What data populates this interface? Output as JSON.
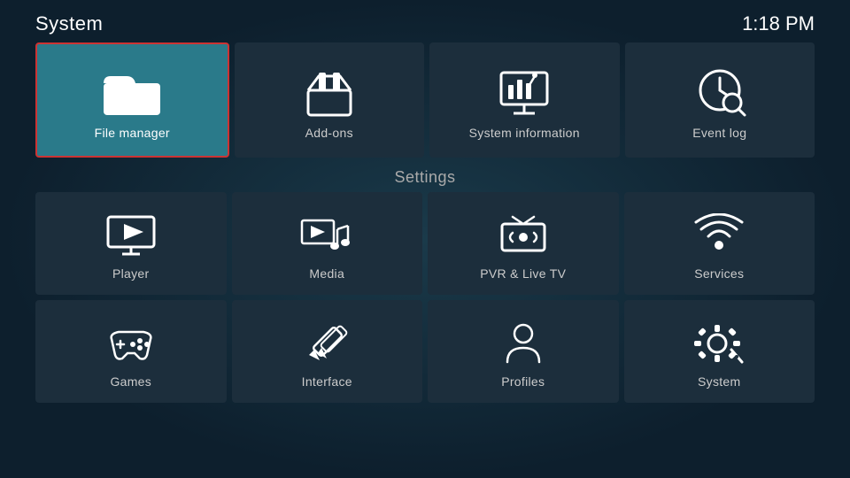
{
  "header": {
    "title": "System",
    "time": "1:18 PM"
  },
  "top_row": [
    {
      "id": "file-manager",
      "label": "File manager",
      "icon": "folder",
      "selected": true
    },
    {
      "id": "add-ons",
      "label": "Add-ons",
      "icon": "addons"
    },
    {
      "id": "system-information",
      "label": "System information",
      "icon": "sysinfo"
    },
    {
      "id": "event-log",
      "label": "Event log",
      "icon": "eventlog"
    }
  ],
  "settings_label": "Settings",
  "settings_row1": [
    {
      "id": "player",
      "label": "Player",
      "icon": "player"
    },
    {
      "id": "media",
      "label": "Media",
      "icon": "media"
    },
    {
      "id": "pvr-live-tv",
      "label": "PVR & Live TV",
      "icon": "pvr"
    },
    {
      "id": "services",
      "label": "Services",
      "icon": "services"
    }
  ],
  "settings_row2": [
    {
      "id": "games",
      "label": "Games",
      "icon": "games"
    },
    {
      "id": "interface",
      "label": "Interface",
      "icon": "interface"
    },
    {
      "id": "profiles",
      "label": "Profiles",
      "icon": "profiles"
    },
    {
      "id": "system",
      "label": "System",
      "icon": "system"
    }
  ]
}
